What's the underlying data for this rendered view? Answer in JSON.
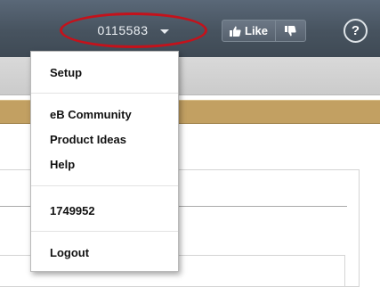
{
  "topbar": {
    "account_number": "0115583",
    "like_label": "Like",
    "help_glyph": "?",
    "colors": {
      "bar": "#47535f",
      "highlight_ring": "#c4121b"
    }
  },
  "menu": {
    "items": [
      {
        "label": "Setup"
      },
      {
        "label": "eB Community"
      },
      {
        "label": "Product Ideas"
      },
      {
        "label": "Help"
      },
      {
        "label": "1749952"
      },
      {
        "label": "Logout"
      }
    ]
  },
  "gold_strip": {
    "color": "#c2a062"
  },
  "icons": [
    "chevron-down-icon",
    "thumbs-up-icon",
    "thumbs-down-icon",
    "help-icon"
  ]
}
